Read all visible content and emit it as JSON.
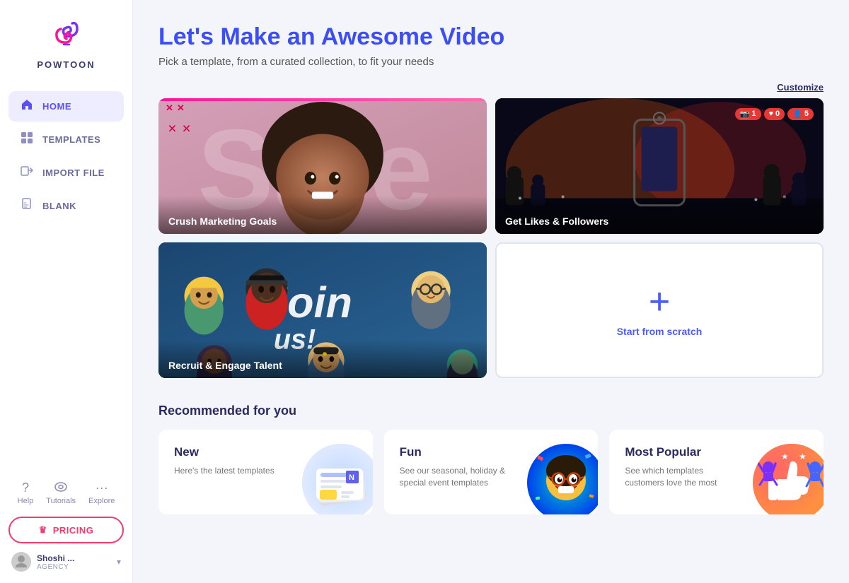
{
  "sidebar": {
    "logo_text": "POWTOON",
    "nav_items": [
      {
        "id": "home",
        "label": "HOME",
        "icon": "🏠",
        "active": true
      },
      {
        "id": "templates",
        "label": "TEMPLATES",
        "icon": "▦",
        "active": false
      },
      {
        "id": "import",
        "label": "IMPORT FILE",
        "icon": "→",
        "active": false
      },
      {
        "id": "blank",
        "label": "BLANK",
        "icon": "📄",
        "active": false
      }
    ],
    "help_items": [
      {
        "id": "help",
        "label": "Help",
        "icon": "?"
      },
      {
        "id": "tutorials",
        "label": "Tutorials",
        "icon": "👁"
      },
      {
        "id": "explore",
        "label": "Explore",
        "icon": "···"
      }
    ],
    "pricing_label": "PRICING",
    "user": {
      "name": "Shoshi ...",
      "role": "AGENCY"
    }
  },
  "main": {
    "title": "Let's Make an Awesome Video",
    "subtitle": "Pick a template, from a curated collection, to fit your needs",
    "customize_label": "Customize",
    "templates": [
      {
        "id": "crush",
        "label": "Crush Marketing Goals",
        "bg": "crush"
      },
      {
        "id": "likes",
        "label": "Get Likes & Followers",
        "bg": "likes"
      },
      {
        "id": "join",
        "label": "Recruit & Engage Talent",
        "bg": "join"
      },
      {
        "id": "scratch",
        "label": "Start from scratch",
        "bg": "scratch",
        "plus": "+"
      }
    ],
    "likes_badges": [
      {
        "icon": "🔔",
        "count": "1"
      },
      {
        "icon": "♥",
        "count": "0"
      },
      {
        "icon": "👤",
        "count": "5"
      }
    ],
    "recommended_title": "Recommended for you",
    "rec_cards": [
      {
        "id": "new",
        "title": "New",
        "desc": "Here's the latest templates"
      },
      {
        "id": "fun",
        "title": "Fun",
        "desc": "See our seasonal, holiday & special event templates"
      },
      {
        "id": "popular",
        "title": "Most Popular",
        "desc": "See which templates customers love the most"
      }
    ]
  }
}
